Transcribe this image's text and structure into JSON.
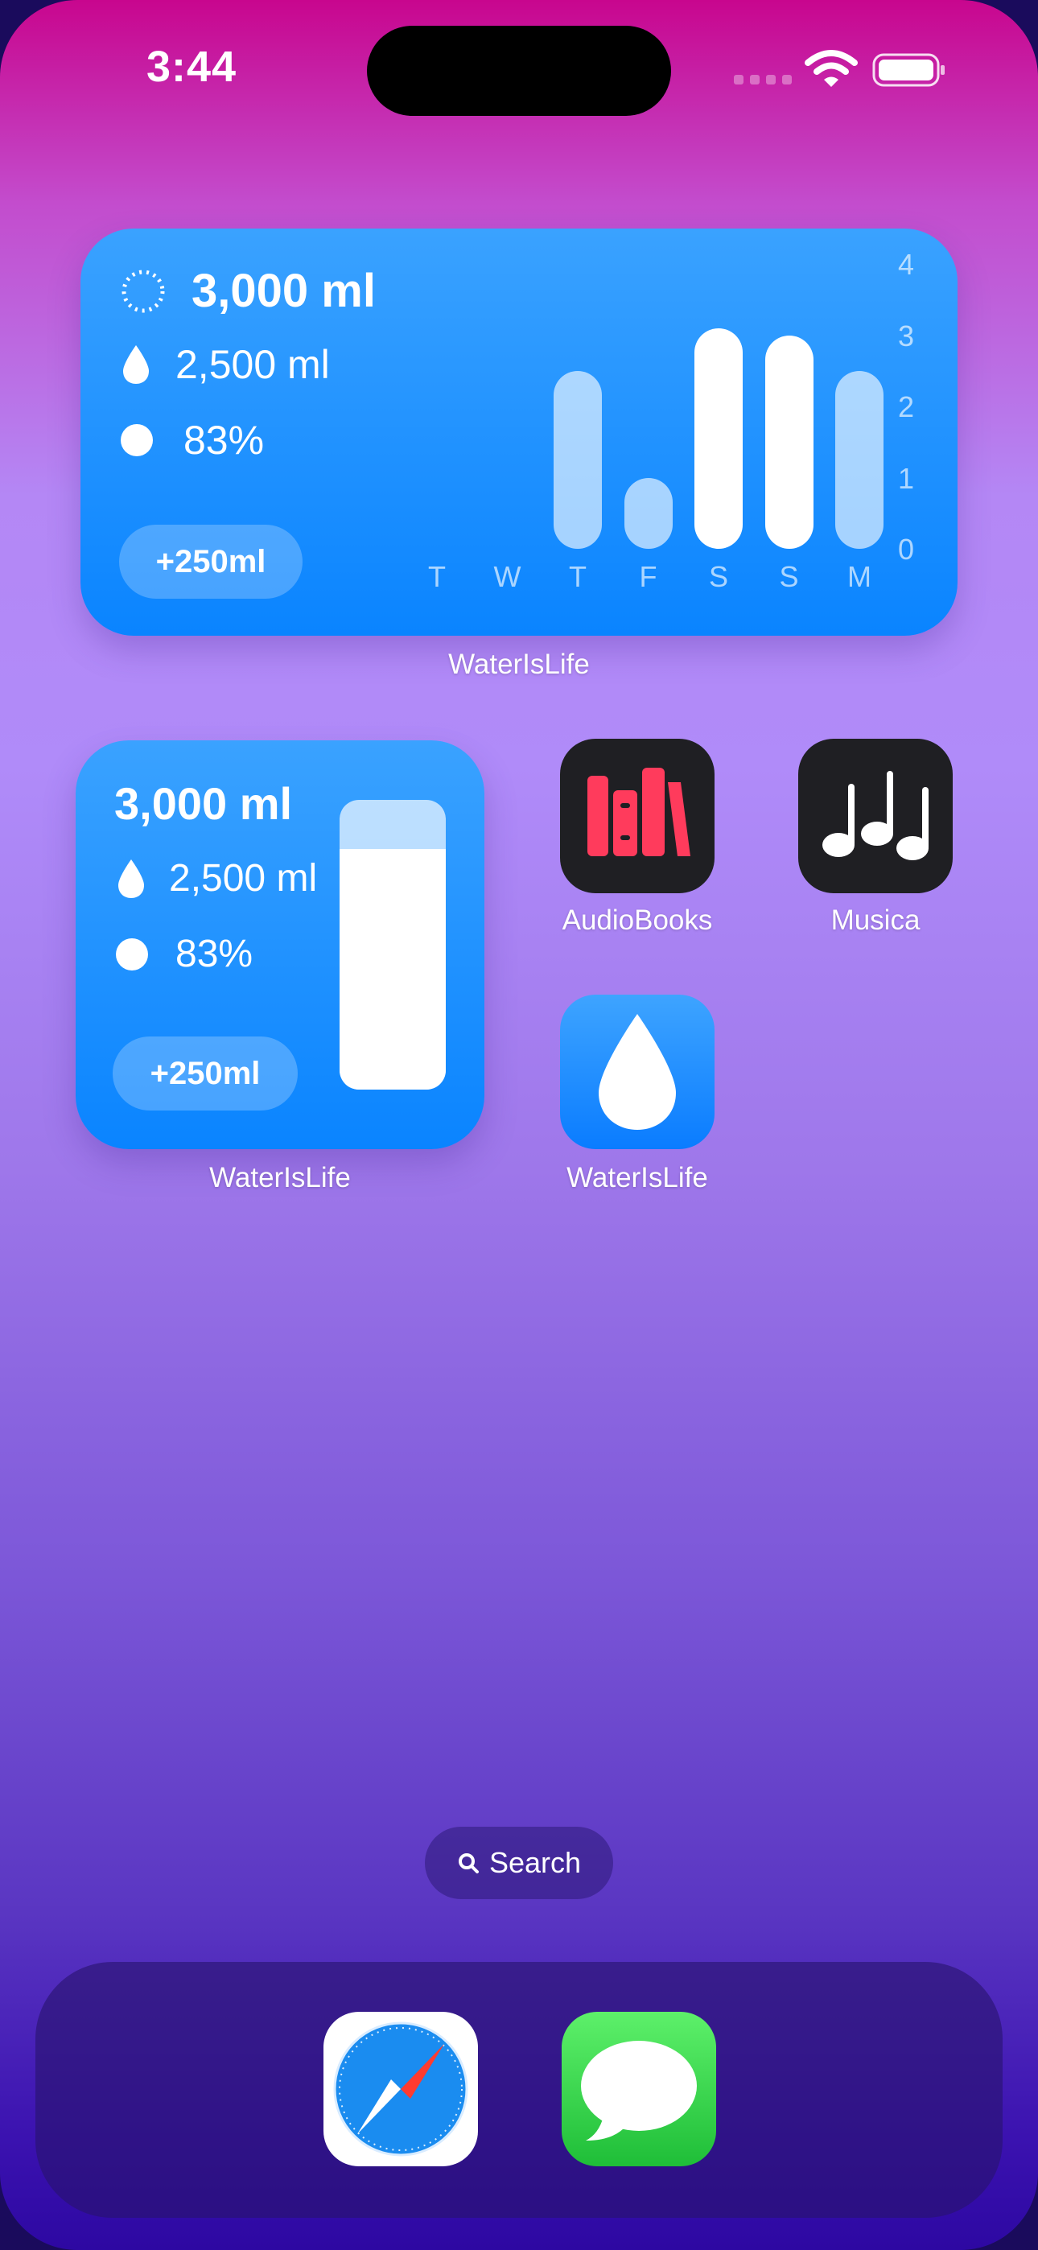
{
  "status_bar": {
    "time": "3:44"
  },
  "widget_large": {
    "goal": "3,000 ml",
    "intake": "2,500 ml",
    "percent": "83%",
    "add_label": "+250ml",
    "caption": "WaterIsLife"
  },
  "chart_data": {
    "type": "bar",
    "categories": [
      "T",
      "W",
      "T",
      "F",
      "S",
      "S",
      "M"
    ],
    "values": [
      0,
      0,
      2.5,
      1,
      3.1,
      3.0,
      2.5
    ],
    "ylim": [
      0,
      4
    ],
    "yticks": [
      "4",
      "3",
      "2",
      "1",
      "0"
    ],
    "grid": false,
    "colors": {
      "full": "#ffffff",
      "partial": "rgba(255,255,255,0.62)"
    }
  },
  "widget_small": {
    "goal": "3,000 ml",
    "intake": "2,500 ml",
    "percent": "83%",
    "add_label": "+250ml",
    "caption": "WaterIsLife",
    "fill_fraction": 0.83
  },
  "apps": {
    "audiobooks": {
      "label": "AudioBooks",
      "icon": "books-icon"
    },
    "musica": {
      "label": "Musica",
      "icon": "music-notes-icon"
    },
    "waterislife": {
      "label": "WaterIsLife",
      "icon": "water-drop-icon"
    }
  },
  "search": {
    "label": "Search"
  },
  "dock": {
    "apps": [
      "safari-icon",
      "messages-icon"
    ]
  },
  "colors": {
    "widget_blue": "#0a84ff",
    "audiobooks_red": "#ff3b5c",
    "messages_green": "#34c759"
  }
}
